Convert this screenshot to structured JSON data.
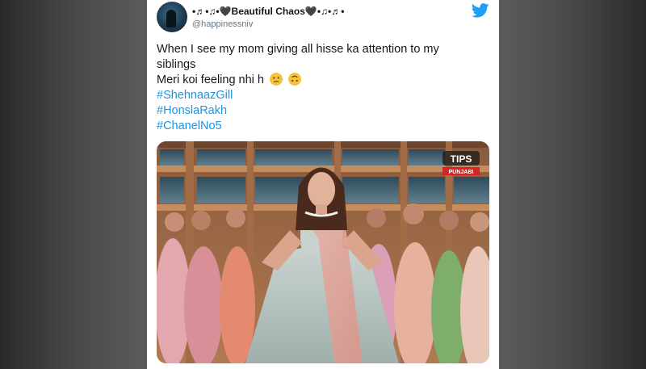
{
  "tweet": {
    "author": {
      "display_name": "•♬•♫•🖤Beautiful Chaos🖤•♫•♬•",
      "handle": "@happinessniv"
    },
    "text_lines": [
      "When I see my mom giving all hisse ka attention to my",
      "siblings",
      "Meri koi feeling nhi h"
    ],
    "emojis": [
      "confused-face-icon",
      "upside-down-face-icon"
    ],
    "hashtags": [
      "#ShehnaazGill",
      "#HonslaRakh",
      "#ChanelNo5"
    ],
    "media": {
      "logo_text": "TIPS",
      "logo_subtext": "PUNJABI"
    }
  },
  "colors": {
    "hashtag": "#1b95e0",
    "twitter_blue": "#1da1f2",
    "text": "#14171a",
    "muted": "#657786"
  }
}
